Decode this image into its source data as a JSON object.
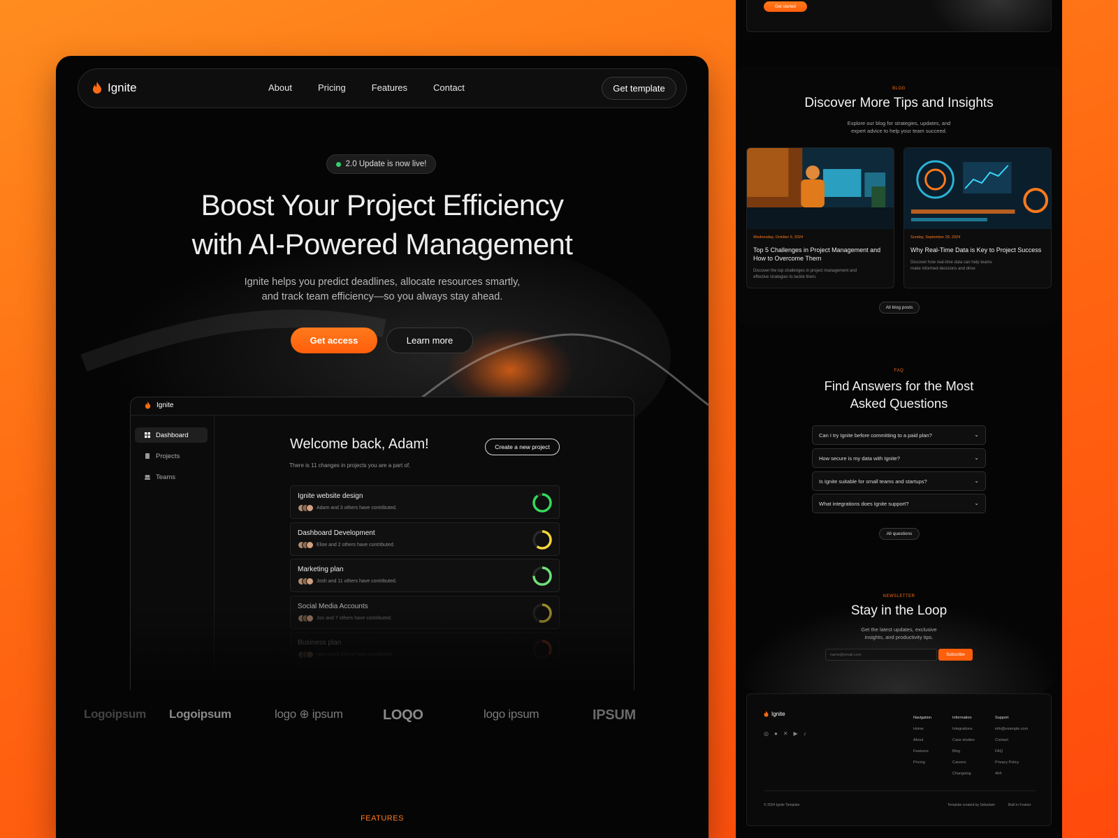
{
  "brand": {
    "name": "Ignite",
    "accent": "#ff6a12",
    "background": "#050505"
  },
  "nav": {
    "links": [
      "About",
      "Pricing",
      "Features",
      "Contact"
    ],
    "cta": "Get template"
  },
  "hero": {
    "badge": "2.0 Update is now live!",
    "title_line1": "Boost Your Project Efficiency",
    "title_line2": "with AI-Powered Management",
    "sub_line1": "Ignite helps you predict deadlines, allocate resources smartly,",
    "sub_line2": "and track team efficiency—so you always stay ahead.",
    "primary_cta": "Get access",
    "secondary_cta": "Learn more"
  },
  "dashboard": {
    "brand": "Ignite",
    "sidebar": [
      {
        "label": "Dashboard",
        "icon": "grid-icon",
        "active": true
      },
      {
        "label": "Projects",
        "icon": "file-icon",
        "active": false
      },
      {
        "label": "Teams",
        "icon": "users-icon",
        "active": false
      }
    ],
    "welcome": "Welcome back, Adam!",
    "changes": "There is 11 changes in projects you are a part of.",
    "create_button": "Create a new project",
    "projects": [
      {
        "name": "Ignite website design",
        "contrib": "Adam and 3 others have contributed.",
        "progress": 0.9,
        "color": "#34d95c"
      },
      {
        "name": "Dashboard Development",
        "contrib": "Elise and 2 others have contributed.",
        "progress": 0.6,
        "color": "#f5d63a"
      },
      {
        "name": "Marketing plan",
        "contrib": "Josh and 11 others have contributed.",
        "progress": 0.75,
        "color": "#6fe07a"
      },
      {
        "name": "Social Media Accounts",
        "contrib": "Jon and 7 others have contributed.",
        "progress": 0.55,
        "color": "#d9c23a"
      },
      {
        "name": "Business plan",
        "contrib": "Ivan and 5 others have contributed.",
        "progress": 0.35,
        "color": "#ff5a2a"
      }
    ]
  },
  "logos": [
    "Logoipsum",
    "Logoipsum",
    "logo ⊕ ipsum",
    "LOQO",
    "logo ipsum",
    "IPSUM"
  ],
  "features_label": "FEATURES",
  "side": {
    "hero_cta": "Get started",
    "blog": {
      "eyebrow": "BLOG",
      "title": "Discover More Tips and Insights",
      "sub_line1": "Explore our blog for strategies, updates, and",
      "sub_line2": "expert advice to help your team succeed.",
      "posts": [
        {
          "date": "Wednesday, October 9, 2024",
          "title": "Top 5 Challenges in Project Management and How to Overcome Them",
          "desc": "Discover the top challenges in project management and effective strategies to tackle them."
        },
        {
          "date": "Sunday, September 29, 2024",
          "title": "Why Real-Time Data is Key to Project Success",
          "desc": "Discover how real-time data can help teams make informed decisions and drive"
        }
      ],
      "all_button": "All blog posts"
    },
    "faq": {
      "eyebrow": "FAQ",
      "title_line1": "Find Answers for the Most",
      "title_line2": "Asked Questions",
      "items": [
        "Can I try Ignite before committing to a paid plan?",
        "How secure is my data with Ignite?",
        "Is Ignite suitable for small teams and startups?",
        "What integrations does Ignite support?"
      ],
      "all_button": "All questions"
    },
    "newsletter": {
      "eyebrow": "NEWSLETTER",
      "title": "Stay in the Loop",
      "sub_line1": "Get the latest updates, exclusive",
      "sub_line2": "insights, and productivity tips.",
      "placeholder": "name@email.com",
      "button": "Subscribe"
    },
    "footer": {
      "brand": "Ignite",
      "social_icons": [
        "instagram-icon",
        "facebook-icon",
        "x-icon",
        "youtube-icon",
        "tiktok-icon"
      ],
      "cols": [
        {
          "title": "Navigation",
          "items": [
            "Home",
            "About",
            "Features",
            "Pricing"
          ]
        },
        {
          "title": "Information",
          "items": [
            "Integrations",
            "Case studies",
            "Blog",
            "Careers",
            "Changelog"
          ]
        },
        {
          "title": "Support",
          "items": [
            "info@example.com",
            "Contact",
            "FAQ",
            "Privacy Policy",
            "404"
          ]
        }
      ],
      "copyright": "© 2024 Ignite Template",
      "credit": "Template created by Sebadam",
      "built": "Built in Framer"
    }
  }
}
